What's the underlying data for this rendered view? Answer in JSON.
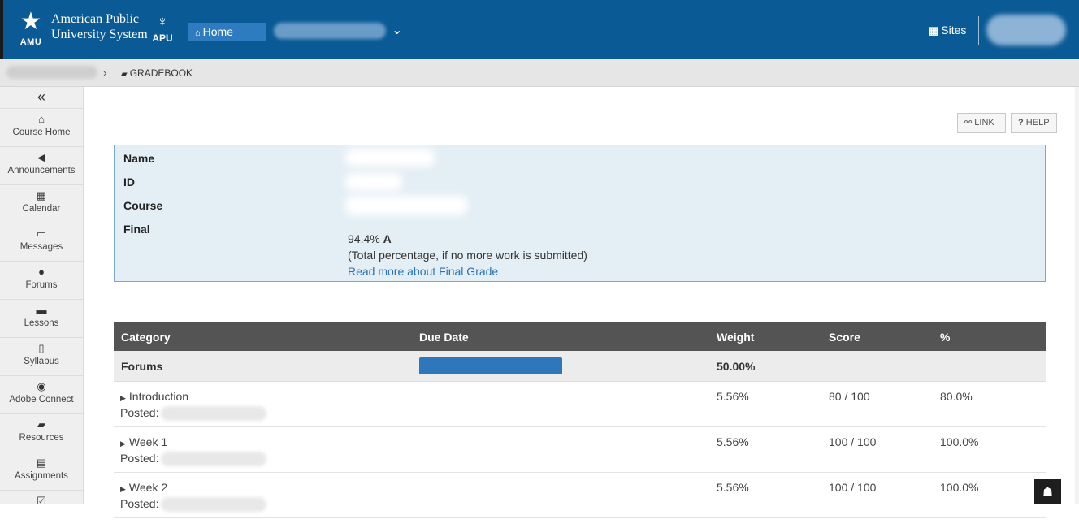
{
  "header": {
    "amu_abbr": "AMU",
    "logo_line1": "American Public",
    "logo_line2": "University System",
    "apu_abbr": "APU",
    "home_label": "Home",
    "sites_label": "Sites"
  },
  "breadcrumb": {
    "current": "GRADEBOOK"
  },
  "sidebar": {
    "collapse": "«",
    "items": [
      {
        "label": "Course Home",
        "icon": "home-icon"
      },
      {
        "label": "Announcements",
        "icon": "bullhorn-icon"
      },
      {
        "label": "Calendar",
        "icon": "calendar-icon"
      },
      {
        "label": "Messages",
        "icon": "inbox-icon"
      },
      {
        "label": "Forums",
        "icon": "comments-icon"
      },
      {
        "label": "Lessons",
        "icon": "book-icon"
      },
      {
        "label": "Syllabus",
        "icon": "map-icon"
      },
      {
        "label": "Adobe Connect",
        "icon": "globe-icon"
      },
      {
        "label": "Resources",
        "icon": "folder-icon"
      },
      {
        "label": "Assignments",
        "icon": "file-icon"
      }
    ]
  },
  "toolbar": {
    "link_label": "LINK",
    "help_label": "HELP"
  },
  "student_info": {
    "name_label": "Name",
    "id_label": "ID",
    "course_label": "Course",
    "final_label": "Final",
    "final_percent": "94.4%",
    "final_letter": "A",
    "final_note": "(Total percentage, if no more work is submitted)",
    "final_link": "Read more about Final Grade"
  },
  "gradebook": {
    "columns": [
      "Category",
      "Due Date",
      "Weight",
      "Score",
      "%"
    ],
    "category": {
      "name": "Forums",
      "weight": "50.00%"
    },
    "posted_label": "Posted:",
    "rows": [
      {
        "name": "Introduction",
        "weight": "5.56%",
        "score": "80 / 100",
        "percent": "80.0%"
      },
      {
        "name": "Week 1",
        "weight": "5.56%",
        "score": "100 / 100",
        "percent": "100.0%"
      },
      {
        "name": "Week 2",
        "weight": "5.56%",
        "score": "100 / 100",
        "percent": "100.0%"
      }
    ]
  },
  "colors": {
    "header_bg": "#0a5a96",
    "accent_blue": "#2e77bb",
    "table_header_bg": "#545454",
    "info_box_bg": "#e4eef5"
  }
}
